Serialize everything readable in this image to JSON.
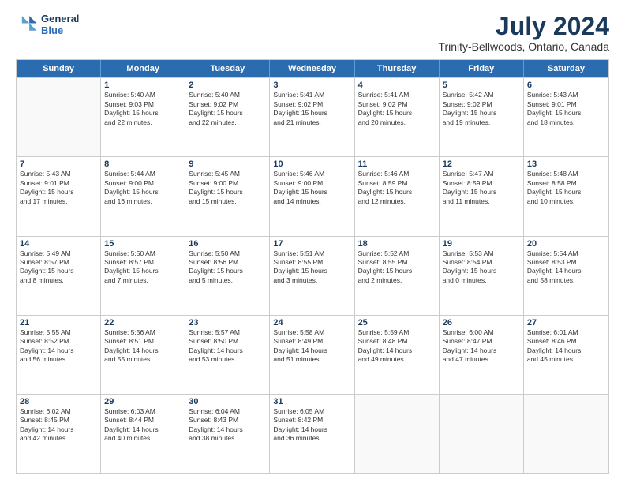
{
  "logo": {
    "line1": "General",
    "line2": "Blue"
  },
  "title": "July 2024",
  "location": "Trinity-Bellwoods, Ontario, Canada",
  "days": [
    "Sunday",
    "Monday",
    "Tuesday",
    "Wednesday",
    "Thursday",
    "Friday",
    "Saturday"
  ],
  "weeks": [
    [
      {
        "date": "",
        "info": ""
      },
      {
        "date": "1",
        "info": "Sunrise: 5:40 AM\nSunset: 9:03 PM\nDaylight: 15 hours\nand 22 minutes."
      },
      {
        "date": "2",
        "info": "Sunrise: 5:40 AM\nSunset: 9:02 PM\nDaylight: 15 hours\nand 22 minutes."
      },
      {
        "date": "3",
        "info": "Sunrise: 5:41 AM\nSunset: 9:02 PM\nDaylight: 15 hours\nand 21 minutes."
      },
      {
        "date": "4",
        "info": "Sunrise: 5:41 AM\nSunset: 9:02 PM\nDaylight: 15 hours\nand 20 minutes."
      },
      {
        "date": "5",
        "info": "Sunrise: 5:42 AM\nSunset: 9:02 PM\nDaylight: 15 hours\nand 19 minutes."
      },
      {
        "date": "6",
        "info": "Sunrise: 5:43 AM\nSunset: 9:01 PM\nDaylight: 15 hours\nand 18 minutes."
      }
    ],
    [
      {
        "date": "7",
        "info": "Sunrise: 5:43 AM\nSunset: 9:01 PM\nDaylight: 15 hours\nand 17 minutes."
      },
      {
        "date": "8",
        "info": "Sunrise: 5:44 AM\nSunset: 9:00 PM\nDaylight: 15 hours\nand 16 minutes."
      },
      {
        "date": "9",
        "info": "Sunrise: 5:45 AM\nSunset: 9:00 PM\nDaylight: 15 hours\nand 15 minutes."
      },
      {
        "date": "10",
        "info": "Sunrise: 5:46 AM\nSunset: 9:00 PM\nDaylight: 15 hours\nand 14 minutes."
      },
      {
        "date": "11",
        "info": "Sunrise: 5:46 AM\nSunset: 8:59 PM\nDaylight: 15 hours\nand 12 minutes."
      },
      {
        "date": "12",
        "info": "Sunrise: 5:47 AM\nSunset: 8:59 PM\nDaylight: 15 hours\nand 11 minutes."
      },
      {
        "date": "13",
        "info": "Sunrise: 5:48 AM\nSunset: 8:58 PM\nDaylight: 15 hours\nand 10 minutes."
      }
    ],
    [
      {
        "date": "14",
        "info": "Sunrise: 5:49 AM\nSunset: 8:57 PM\nDaylight: 15 hours\nand 8 minutes."
      },
      {
        "date": "15",
        "info": "Sunrise: 5:50 AM\nSunset: 8:57 PM\nDaylight: 15 hours\nand 7 minutes."
      },
      {
        "date": "16",
        "info": "Sunrise: 5:50 AM\nSunset: 8:56 PM\nDaylight: 15 hours\nand 5 minutes."
      },
      {
        "date": "17",
        "info": "Sunrise: 5:51 AM\nSunset: 8:55 PM\nDaylight: 15 hours\nand 3 minutes."
      },
      {
        "date": "18",
        "info": "Sunrise: 5:52 AM\nSunset: 8:55 PM\nDaylight: 15 hours\nand 2 minutes."
      },
      {
        "date": "19",
        "info": "Sunrise: 5:53 AM\nSunset: 8:54 PM\nDaylight: 15 hours\nand 0 minutes."
      },
      {
        "date": "20",
        "info": "Sunrise: 5:54 AM\nSunset: 8:53 PM\nDaylight: 14 hours\nand 58 minutes."
      }
    ],
    [
      {
        "date": "21",
        "info": "Sunrise: 5:55 AM\nSunset: 8:52 PM\nDaylight: 14 hours\nand 56 minutes."
      },
      {
        "date": "22",
        "info": "Sunrise: 5:56 AM\nSunset: 8:51 PM\nDaylight: 14 hours\nand 55 minutes."
      },
      {
        "date": "23",
        "info": "Sunrise: 5:57 AM\nSunset: 8:50 PM\nDaylight: 14 hours\nand 53 minutes."
      },
      {
        "date": "24",
        "info": "Sunrise: 5:58 AM\nSunset: 8:49 PM\nDaylight: 14 hours\nand 51 minutes."
      },
      {
        "date": "25",
        "info": "Sunrise: 5:59 AM\nSunset: 8:48 PM\nDaylight: 14 hours\nand 49 minutes."
      },
      {
        "date": "26",
        "info": "Sunrise: 6:00 AM\nSunset: 8:47 PM\nDaylight: 14 hours\nand 47 minutes."
      },
      {
        "date": "27",
        "info": "Sunrise: 6:01 AM\nSunset: 8:46 PM\nDaylight: 14 hours\nand 45 minutes."
      }
    ],
    [
      {
        "date": "28",
        "info": "Sunrise: 6:02 AM\nSunset: 8:45 PM\nDaylight: 14 hours\nand 42 minutes."
      },
      {
        "date": "29",
        "info": "Sunrise: 6:03 AM\nSunset: 8:44 PM\nDaylight: 14 hours\nand 40 minutes."
      },
      {
        "date": "30",
        "info": "Sunrise: 6:04 AM\nSunset: 8:43 PM\nDaylight: 14 hours\nand 38 minutes."
      },
      {
        "date": "31",
        "info": "Sunrise: 6:05 AM\nSunset: 8:42 PM\nDaylight: 14 hours\nand 36 minutes."
      },
      {
        "date": "",
        "info": ""
      },
      {
        "date": "",
        "info": ""
      },
      {
        "date": "",
        "info": ""
      }
    ]
  ]
}
